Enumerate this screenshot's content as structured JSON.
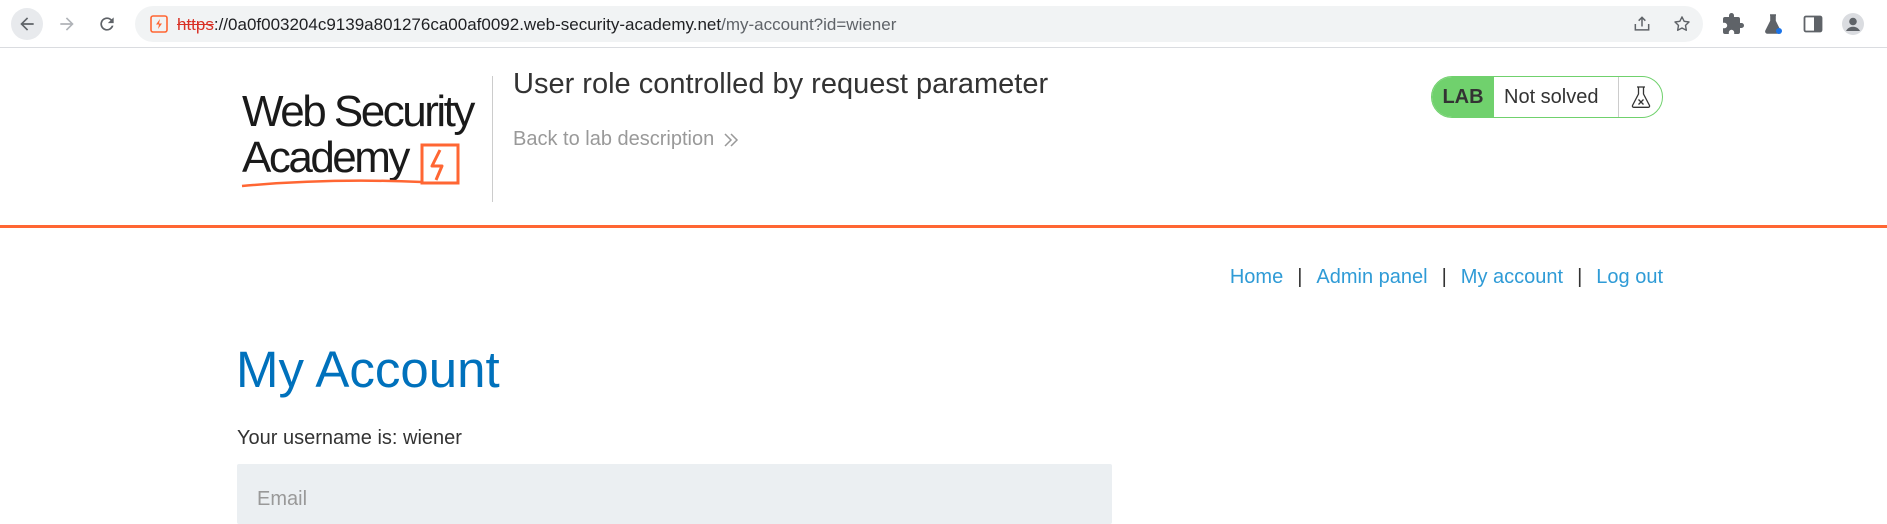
{
  "browser": {
    "url_scheme": "https",
    "url_rest": "://0a0f003204c9139a801276ca00af0092.web-security-academy.net",
    "url_path": "/my-account?id=wiener"
  },
  "header": {
    "lab_title": "User role controlled by request parameter",
    "back_link": "Back to lab description",
    "status_label": "LAB",
    "status_text": "Not solved"
  },
  "logo": {
    "line1": "Web Security",
    "line2": "Academy"
  },
  "nav": {
    "home": "Home",
    "admin_panel": "Admin panel",
    "my_account": "My account",
    "log_out": "Log out",
    "separator": "|"
  },
  "main": {
    "heading": "My Account",
    "username_line": "Your username is: wiener",
    "email_placeholder": "Email"
  },
  "colors": {
    "accent": "#ff6633",
    "link": "#2f9bd6",
    "heading": "#0071bc",
    "lab_green": "#70d16d"
  }
}
